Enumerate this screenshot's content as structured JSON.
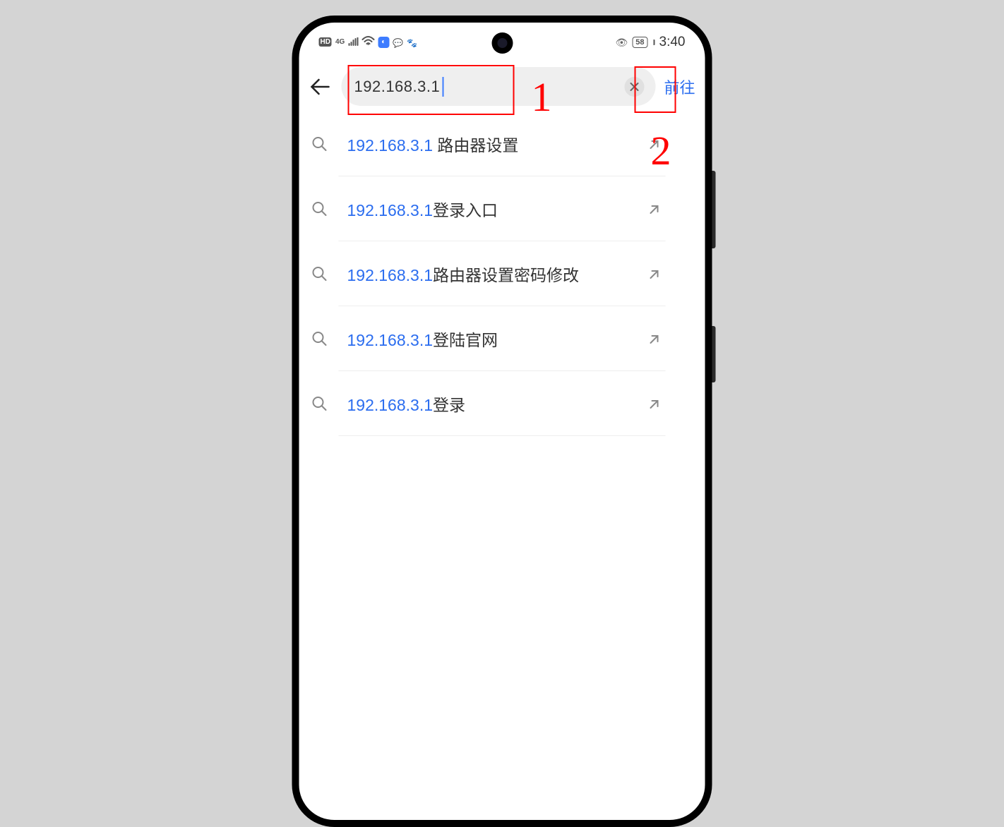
{
  "status": {
    "hd": "HD",
    "net": "4G",
    "battery": "58",
    "time": "3:40"
  },
  "address": {
    "url": "192.168.3.1",
    "go_label": "前往"
  },
  "annotations": {
    "one": "1",
    "two": "2"
  },
  "suggestions": [
    {
      "match": "192.168.3.1",
      "rest": " 路由器设置"
    },
    {
      "match": "192.168.3.1",
      "rest": "登录入口"
    },
    {
      "match": "192.168.3.1",
      "rest": "路由器设置密码修改"
    },
    {
      "match": "192.168.3.1",
      "rest": "登陆官网"
    },
    {
      "match": "192.168.3.1",
      "rest": "登录"
    }
  ]
}
